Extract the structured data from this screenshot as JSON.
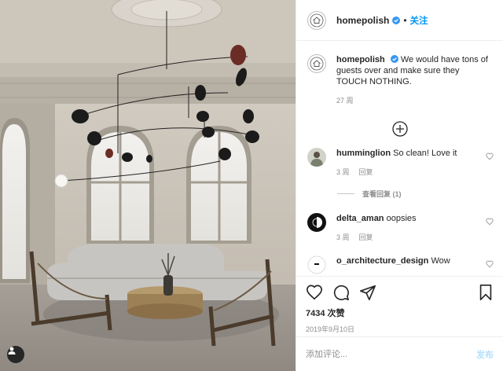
{
  "header": {
    "username": "homepolish",
    "separator": "•",
    "follow_label": "关注"
  },
  "caption": {
    "username": "homepolish",
    "text": "We would have tons of guests over and make sure they TOUCH NOTHING.",
    "time": "27 周"
  },
  "comments": [
    {
      "username": "humminglion",
      "text": "So clean! Love it",
      "time": "3 周",
      "reply_label": "回复",
      "view_replies": "查看回复 (1)"
    },
    {
      "username": "delta_aman",
      "text": "oopsies",
      "time": "3 周",
      "reply_label": "回复"
    },
    {
      "username": "o_architecture_design",
      "text": "Wow"
    }
  ],
  "actions": {
    "likes": "7434 次赞",
    "date": "2019年9月10日"
  },
  "add_comment": {
    "placeholder": "添加评论...",
    "post_label": "发布"
  },
  "icons": {
    "left": [
      "heart-icon",
      "comment-icon",
      "share-icon"
    ],
    "right": [
      "bookmark-icon"
    ],
    "other": [
      "verified-badge-icon",
      "load-more-plus-icon",
      "tagged-user-icon"
    ]
  },
  "colors": {
    "link_blue": "#0095f6",
    "post_disabled": "#b2dffc",
    "meta_gray": "#8e8e8e",
    "text": "#262626"
  }
}
